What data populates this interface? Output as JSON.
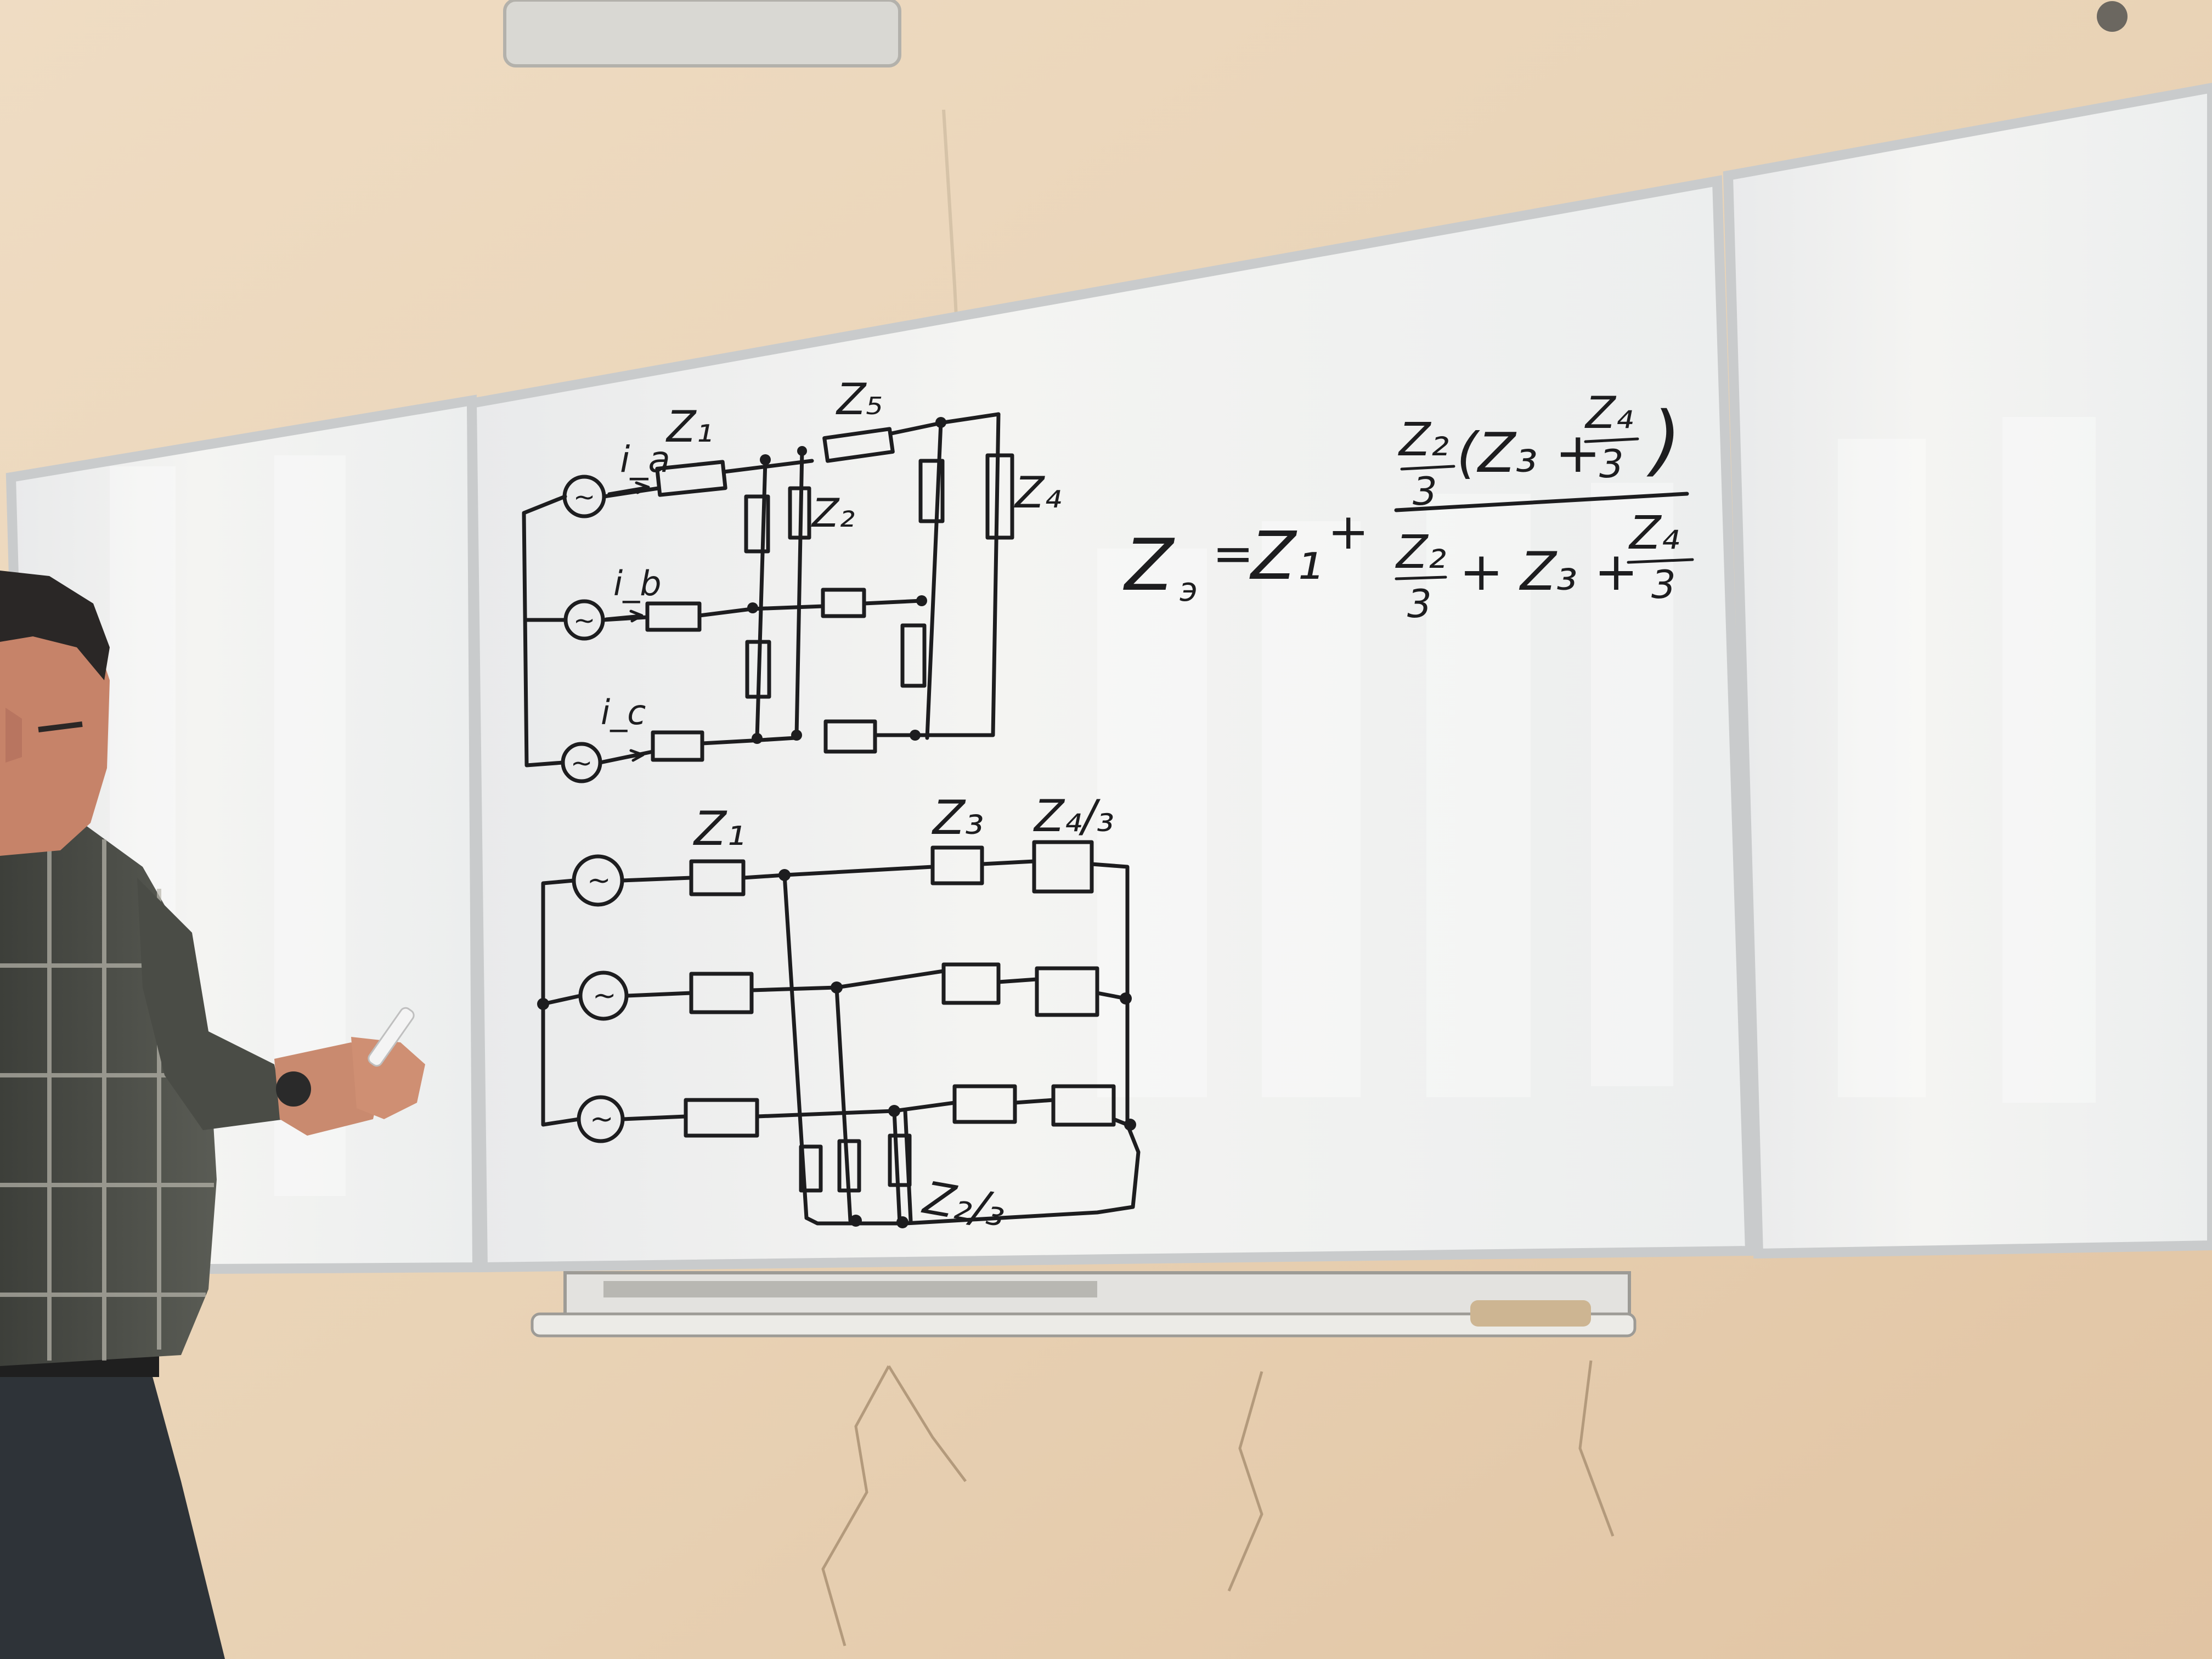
{
  "scene": {
    "description_free": true,
    "wall_color": "#e8d2b6",
    "board_color": "#f2f1ee",
    "frame_color": "#c9cbcc",
    "ink_color": "#1d1d1f"
  },
  "top_circuit": {
    "current_labels": [
      "i_a",
      "i_b",
      "i_c"
    ],
    "impedance_labels": {
      "z1": "Z₁",
      "z5": "Z₅",
      "z2": "Z₂",
      "z4": "Z₄"
    },
    "source_symbol": "~"
  },
  "bottom_circuit": {
    "impedance_labels": {
      "z1": "Z₁",
      "z3": "Z₃",
      "z4_over_3": "Z₄/₃",
      "z2_over_3": "Z₂/₃"
    },
    "source_symbol": "~"
  },
  "formula": {
    "lhs": "Z",
    "lhs_sub": "э",
    "eq": "=",
    "term1": "Z₁",
    "plus": "+",
    "num_left_num": "Z₂",
    "num_left_den": "3",
    "num_paren": "(Z₃ +",
    "num_right_num": "Z₄",
    "num_right_den": "3",
    "num_paren_close": ")",
    "den_left_num": "Z₂",
    "den_left_den": "3",
    "den_mid": "+ Z₃ +",
    "den_right_num": "Z₄",
    "den_right_den": "3"
  }
}
